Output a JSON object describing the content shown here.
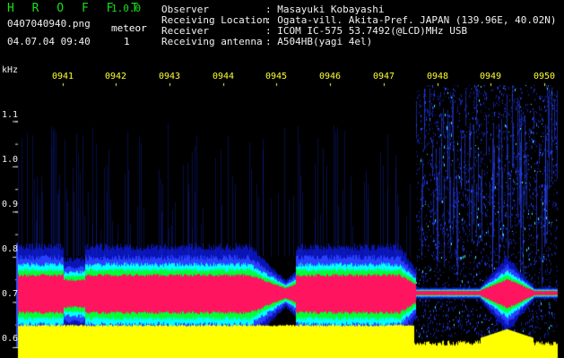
{
  "header": {
    "app_title": "H R O F F T",
    "version": "1.0.0",
    "filename": "0407040940.png",
    "datetime": "04.07.04 09:40",
    "meteor_label": "meteor",
    "meteor_count": "1"
  },
  "info": [
    {
      "label": "Observer",
      "value": ": Masayuki Kobayashi"
    },
    {
      "label": "Receiving Location",
      "value": ": Ogata-vill. Akita-Pref. JAPAN (139.96E, 40.02N)"
    },
    {
      "label": "Receiver",
      "value": ": ICOM IC-575 53.7492(@LCD)MHz USB"
    },
    {
      "label": "Receiving antenna",
      "value": ": A504HB(yagi 4el)"
    }
  ],
  "chart_data": {
    "type": "heatmap",
    "ylabel": "kHz",
    "y_ticks": [
      "1.1",
      "1.0",
      "0.9",
      "0.8",
      "0.7",
      "0.6"
    ],
    "x_ticks": [
      "0941",
      "0942",
      "0943",
      "0944",
      "0945",
      "0946",
      "0947",
      "0948",
      "0949",
      "0950"
    ],
    "ylim": [
      0.58,
      1.18
    ],
    "signal_center_khz": 0.72,
    "colors": {
      "background": "#000000",
      "low": "#0a14c8",
      "mid_low": "#00ffff",
      "mid": "#00ff33",
      "peak": "#ff1460",
      "level_bar": "#ffff00",
      "tick_text": "#ffff33"
    }
  }
}
